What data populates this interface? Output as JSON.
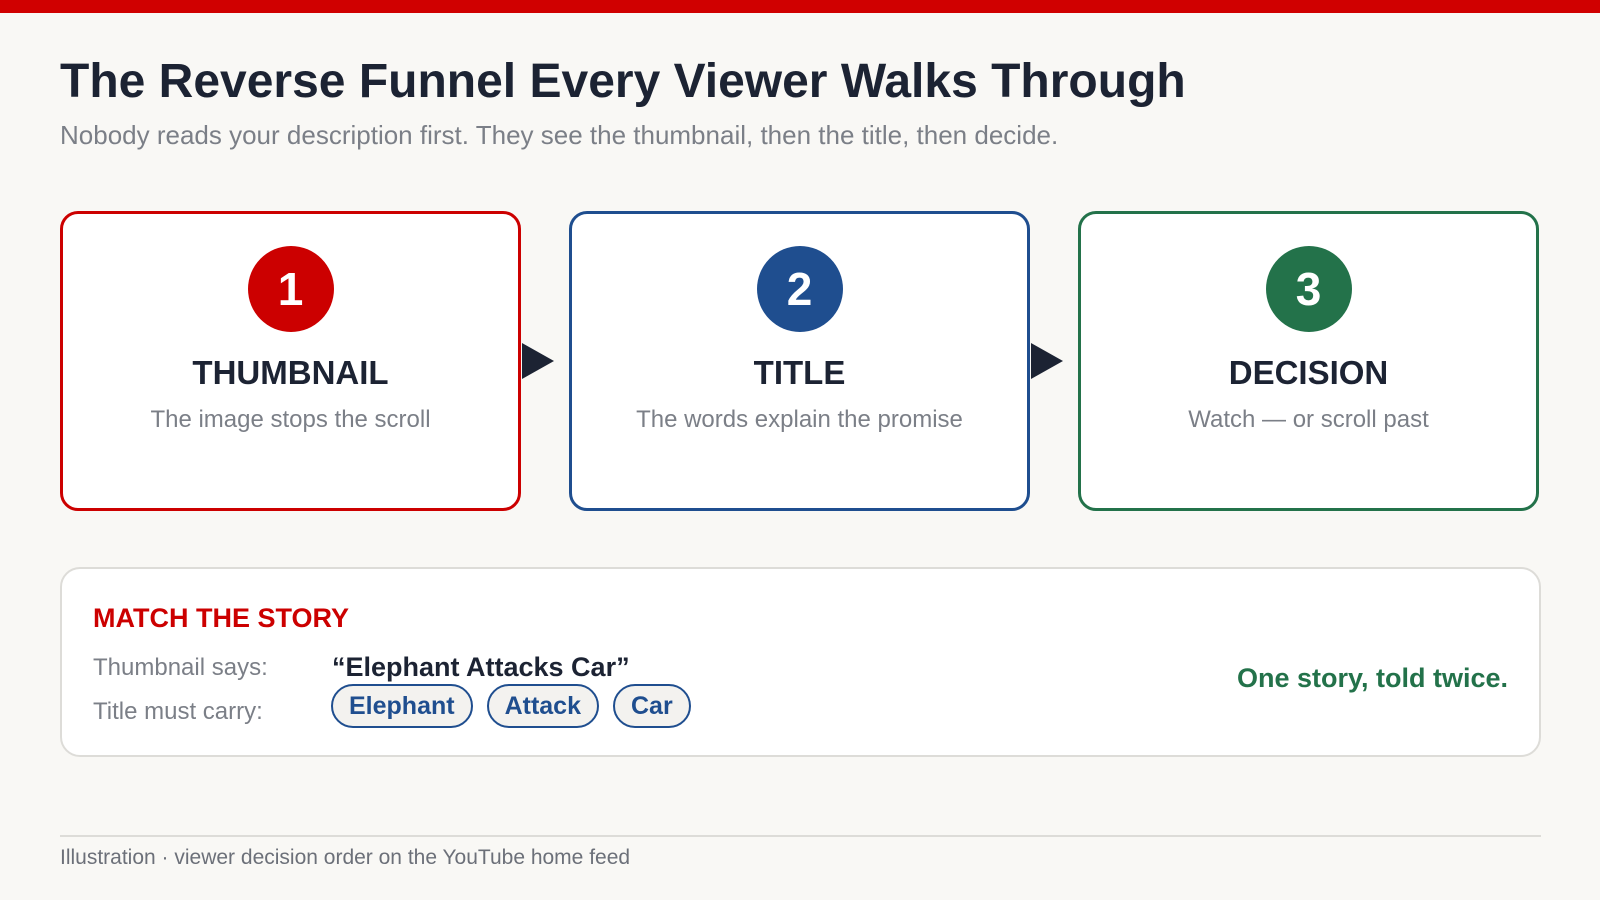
{
  "title": "The Reverse Funnel Every Viewer Walks Through",
  "subtitle": "Nobody reads your description first. They see the thumbnail, then the title, then decide.",
  "steps": [
    {
      "number": "1",
      "label": "THUMBNAIL",
      "desc": "The image stops the scroll",
      "color": "#cc0000"
    },
    {
      "number": "2",
      "label": "TITLE",
      "desc": "The words explain the promise",
      "color": "#1f4e8f"
    },
    {
      "number": "3",
      "label": "DECISION",
      "desc": "Watch — or scroll past",
      "color": "#23724a"
    }
  ],
  "match": {
    "heading": "MATCH THE STORY",
    "thumbnail_label": "Thumbnail says:",
    "thumbnail_quote": "“Elephant Attacks Car”",
    "title_label": "Title must carry:",
    "keywords": [
      "Elephant",
      "Attack",
      "Car"
    ],
    "tagline": "One story, told twice."
  },
  "footer": {
    "caption": "Illustration · viewer decision order on the YouTube home feed"
  },
  "colors": {
    "accent_red": "#d00000",
    "blue": "#1f4e8f",
    "green": "#23724a",
    "ink": "#1c2333"
  }
}
